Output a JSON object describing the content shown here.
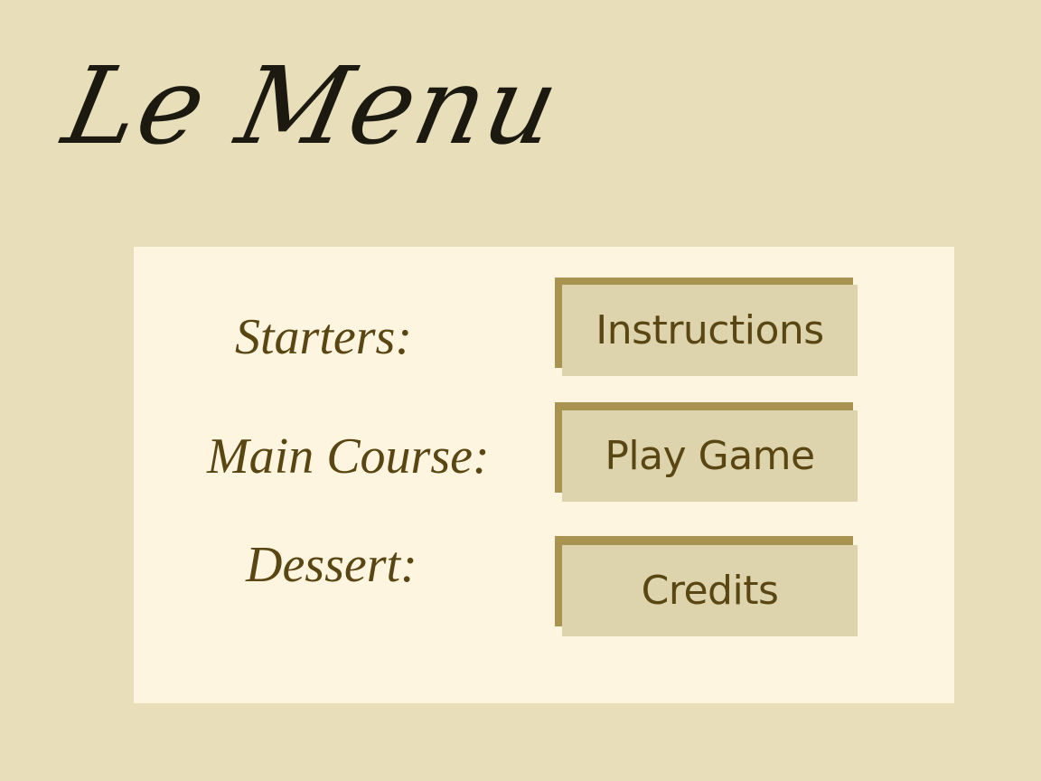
{
  "title": "Le Menu",
  "menu": {
    "courses": [
      {
        "label": "Starters:",
        "button_label": "Instructions"
      },
      {
        "label": "Main Course:",
        "button_label": "Play Game"
      },
      {
        "label": "Dessert:",
        "button_label": "Credits"
      }
    ]
  },
  "colors": {
    "background": "#e8dfba",
    "panel": "#fdf5df",
    "title_text": "#1c1a10",
    "label_text": "#5a4612",
    "button_face": "#ddd3ad",
    "button_shadow": "#a89350"
  }
}
